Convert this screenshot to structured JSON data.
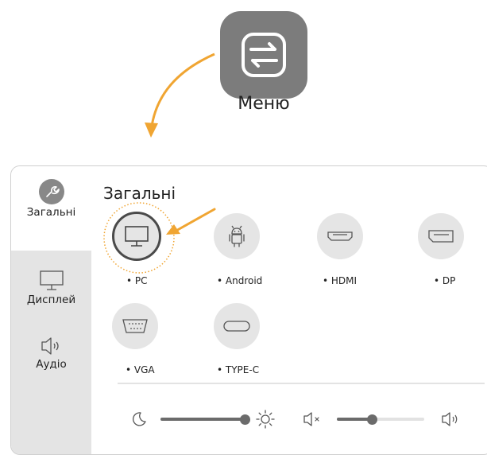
{
  "menu": {
    "label": "Меню",
    "icon": "swap-arrows-icon"
  },
  "panel": {
    "title": "Загальні",
    "sidebar": [
      {
        "label": "Загальні",
        "icon": "wrench-icon",
        "active": true
      },
      {
        "label": "Дисплей",
        "icon": "monitor-icon",
        "active": false
      },
      {
        "label": "Аудіо",
        "icon": "speaker-icon",
        "active": false
      }
    ],
    "sources": [
      {
        "label": "• PC",
        "icon": "monitor-icon",
        "selected": true
      },
      {
        "label": "• Android",
        "icon": "android-icon",
        "selected": false
      },
      {
        "label": "• HDMI",
        "icon": "hdmi-port-icon",
        "selected": false
      },
      {
        "label": "• DP",
        "icon": "displayport-icon",
        "selected": false
      },
      {
        "label": "• VGA",
        "icon": "vga-port-icon",
        "selected": false
      },
      {
        "label": "• TYPE-C",
        "icon": "usb-c-port-icon",
        "selected": false
      }
    ],
    "brightness": {
      "level": 0.95,
      "icons": [
        "moon-icon",
        "sun-icon"
      ]
    },
    "volume": {
      "level": 0.4,
      "icons": [
        "mute-icon",
        "volume-icon"
      ]
    }
  },
  "colors": {
    "accent": "#f0a532",
    "icon_dark": "#555555",
    "sidebar_bg": "#e4e4e4"
  }
}
